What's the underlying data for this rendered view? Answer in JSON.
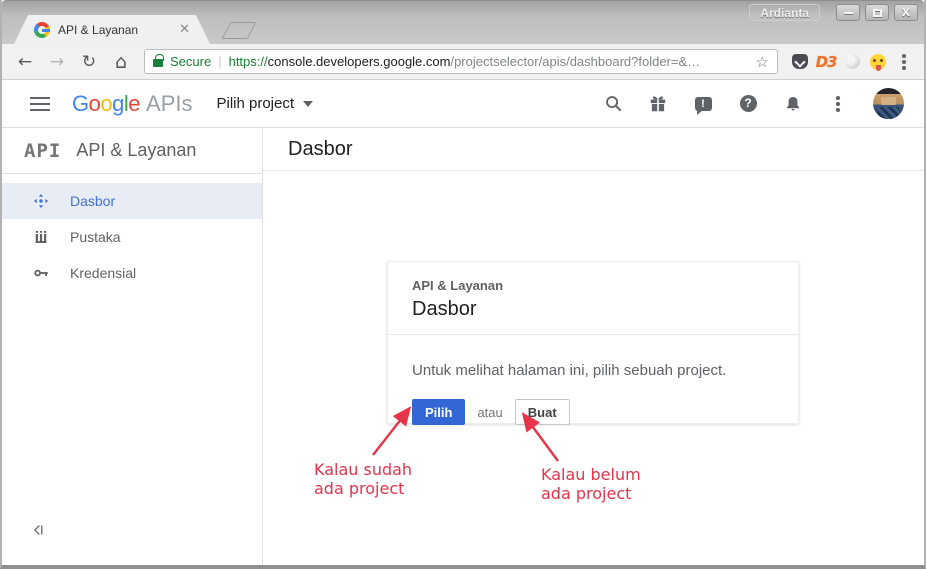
{
  "window": {
    "title": "Ardianta"
  },
  "browser": {
    "tab_title": "API & Layanan",
    "url": {
      "secure_label": "Secure",
      "scheme": "https://",
      "host": "console.developers.google.com",
      "path": "/projectselector/apis/dashboard?folder=&…"
    },
    "extensions": {
      "d3_label": "D3"
    }
  },
  "header": {
    "logo": {
      "letters": [
        {
          "ch": "G",
          "color": "#4285F4"
        },
        {
          "ch": "o",
          "color": "#EA4335"
        },
        {
          "ch": "o",
          "color": "#FBBC05"
        },
        {
          "ch": "g",
          "color": "#4285F4"
        },
        {
          "ch": "l",
          "color": "#34A853"
        },
        {
          "ch": "e",
          "color": "#EA4335"
        }
      ],
      "suffix": "APIs"
    },
    "project_selector_label": "Pilih project"
  },
  "sidebar": {
    "logo_text": "API",
    "title": "API & Layanan",
    "items": [
      {
        "label": "Dasbor",
        "selected": true
      },
      {
        "label": "Pustaka",
        "selected": false
      },
      {
        "label": "Kredensial",
        "selected": false
      }
    ]
  },
  "main": {
    "page_title": "Dasbor",
    "card": {
      "eyebrow": "API & Layanan",
      "title": "Dasbor",
      "message": "Untuk melihat halaman ini, pilih sebuah project.",
      "primary_button": "Pilih",
      "conjunction": "atau",
      "secondary_button": "Buat"
    },
    "annotations": {
      "left": {
        "line1": "Kalau sudah",
        "line2": "ada project"
      },
      "right": {
        "line1": "Kalau belum",
        "line2": "ada project"
      }
    }
  },
  "colors": {
    "primary_blue": "#3367d6",
    "selected_blue": "#4272d9",
    "annotation_red": "#e8334a",
    "secure_green": "#188038"
  }
}
